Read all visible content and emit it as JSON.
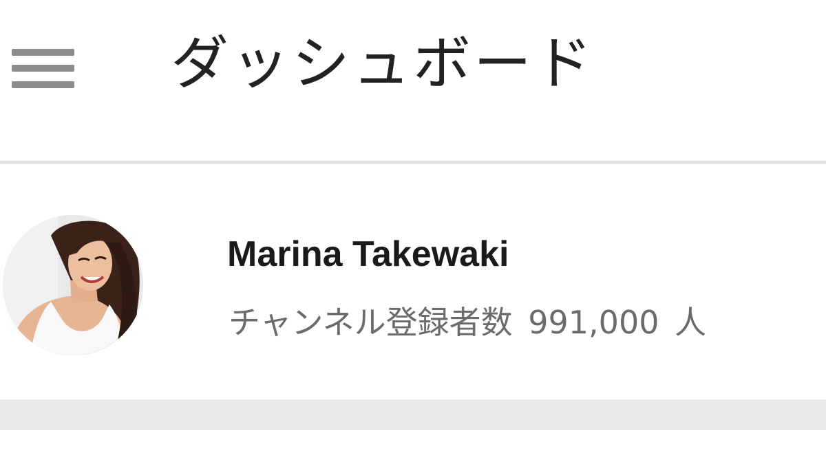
{
  "header": {
    "menu_icon": "hamburger-menu-icon",
    "title": "ダッシュボード"
  },
  "channel": {
    "name": "Marina Takewaki",
    "subscriber_label": "チャンネル登録者数",
    "subscriber_count": "991,000",
    "subscriber_unit": "人",
    "avatar_icon": "profile-photo"
  },
  "colors": {
    "background": "#ffffff",
    "title_text": "#222222",
    "name_text": "#1a1a1a",
    "secondary_text": "#6b6b6b",
    "menu_icon": "#8c8c8c",
    "divider": "#e2e2e2",
    "section_band": "#e9e9e9"
  }
}
